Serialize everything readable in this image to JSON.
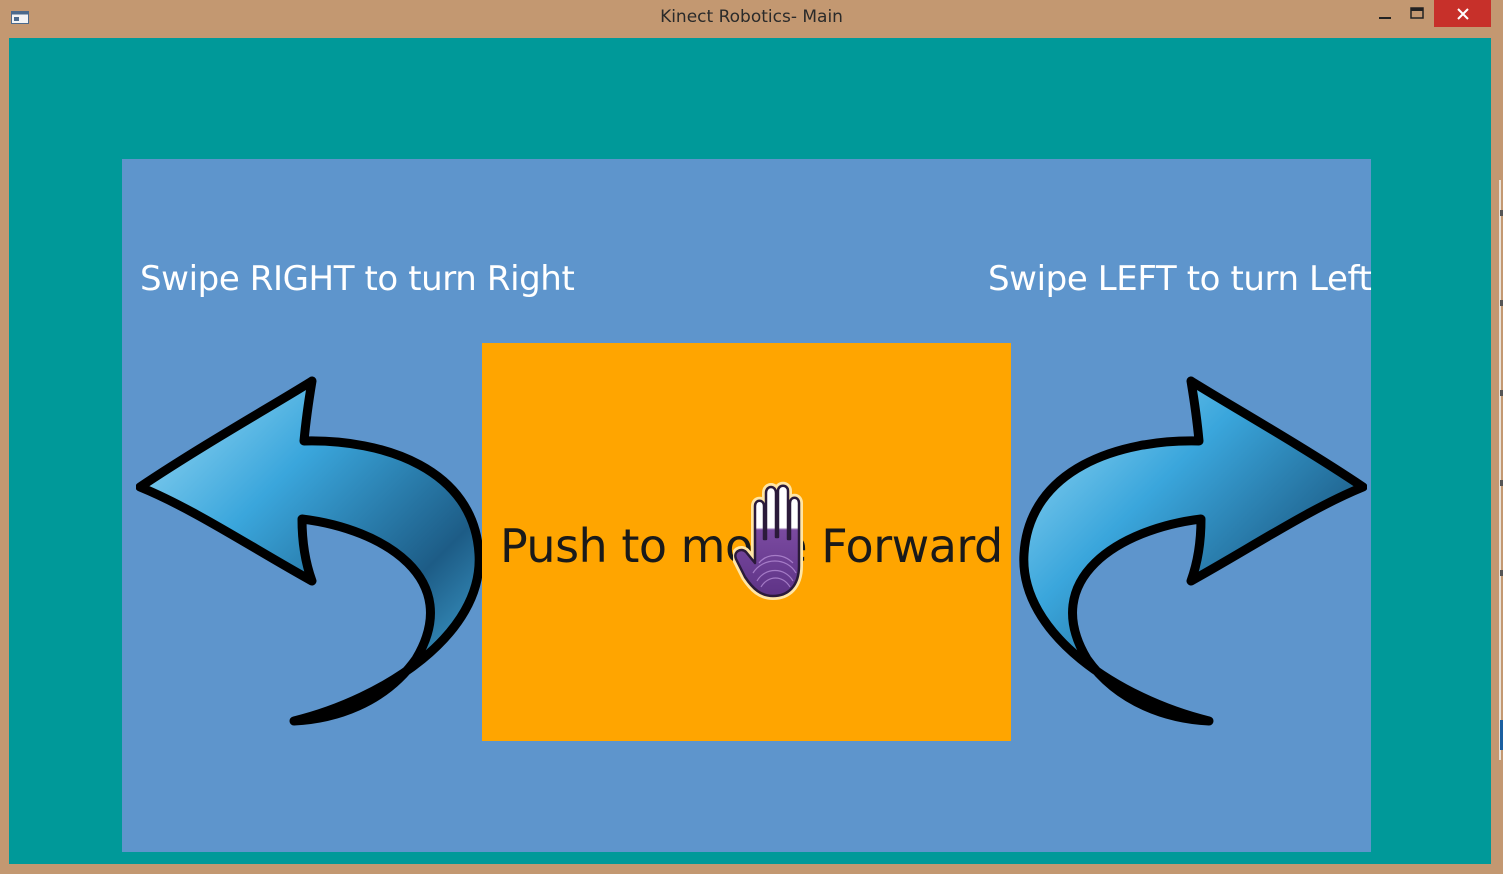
{
  "window": {
    "title": "Kinect Robotics- Main",
    "controls": {
      "minimize_icon": "minimize-icon",
      "maximize_icon": "maximize-icon",
      "close_icon": "close-icon"
    }
  },
  "panel": {
    "swipe_right_text": "Swipe RIGHT to turn Right",
    "swipe_left_text": "Swipe LEFT to turn Left",
    "push_text": "Push to move Forward"
  },
  "colors": {
    "titlebar": "#c39871",
    "background": "#009999",
    "panel": "#5e95cc",
    "button": "#ffa500",
    "close": "#c7302a",
    "hand": "#6b3f8f"
  },
  "icons": {
    "left_arrow": "curved-arrow-left-icon",
    "right_arrow": "curved-arrow-right-icon",
    "cursor": "kinect-hand-cursor-icon"
  }
}
